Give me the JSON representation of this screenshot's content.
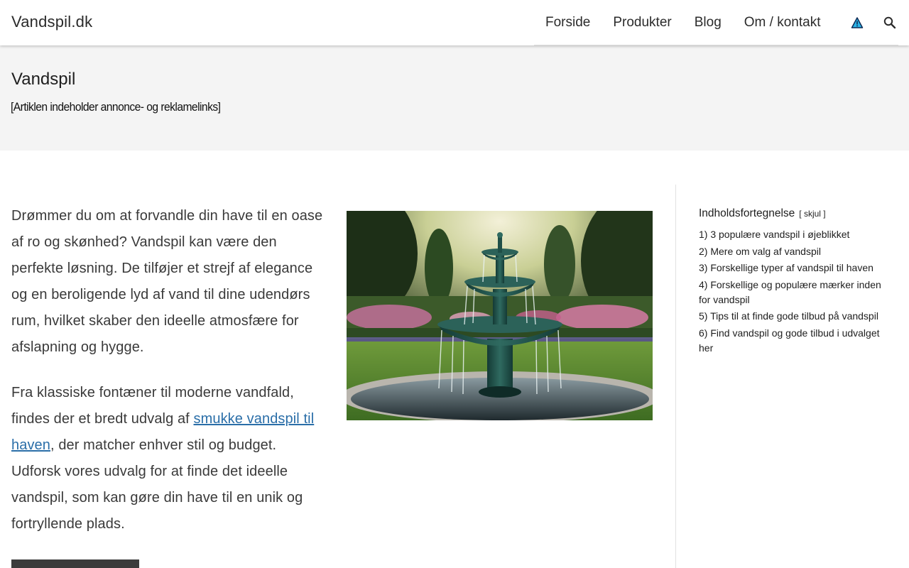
{
  "header": {
    "brand": "Vandspil.dk",
    "nav": [
      "Forside",
      "Produkter",
      "Blog",
      "Om / kontakt"
    ],
    "icons": [
      "warning-triangle-icon",
      "search-icon"
    ]
  },
  "page": {
    "title": "Vandspil",
    "disclaimer": "[Artiklen indeholder annonce- og reklamelinks]"
  },
  "content": {
    "p1": "Drømmer du om at forvandle din have til en oase af ro og skønhed? Vandspil kan være den perfekte løsning. De tilføjer et strejf af elegance og en beroligende lyd af vand til dine udendørs rum, hvilket skaber den ideelle atmosfære for afslapning og hygge.",
    "p2_before": "Fra klassiske fontæner til moderne vandfald, findes der et bredt udvalg af ",
    "p2_link": "smukke vandspil til haven",
    "p2_after": ", der matcher enhver stil og budget. Udforsk vores udvalg for at finde det ideelle vandspil, som kan gøre din have til en unik og fortryllende plads."
  },
  "toc": {
    "title": "Indholdsfortegnelse",
    "toggle": "[ skjul ]",
    "items": [
      "1) 3 populære vandspil i øjeblikket",
      "2) Mere om valg af vandspil",
      "3) Forskellige typer af vandspil til haven",
      "4) Forskellige og populære mærker inden for vandspil",
      "5) Tips til at finde gode tilbud på vandspil",
      "6) Find vandspil og gode tilbud i udvalget her"
    ]
  },
  "colors": {
    "link": "#2a6ea8",
    "title_band": "#f4f4f4"
  }
}
